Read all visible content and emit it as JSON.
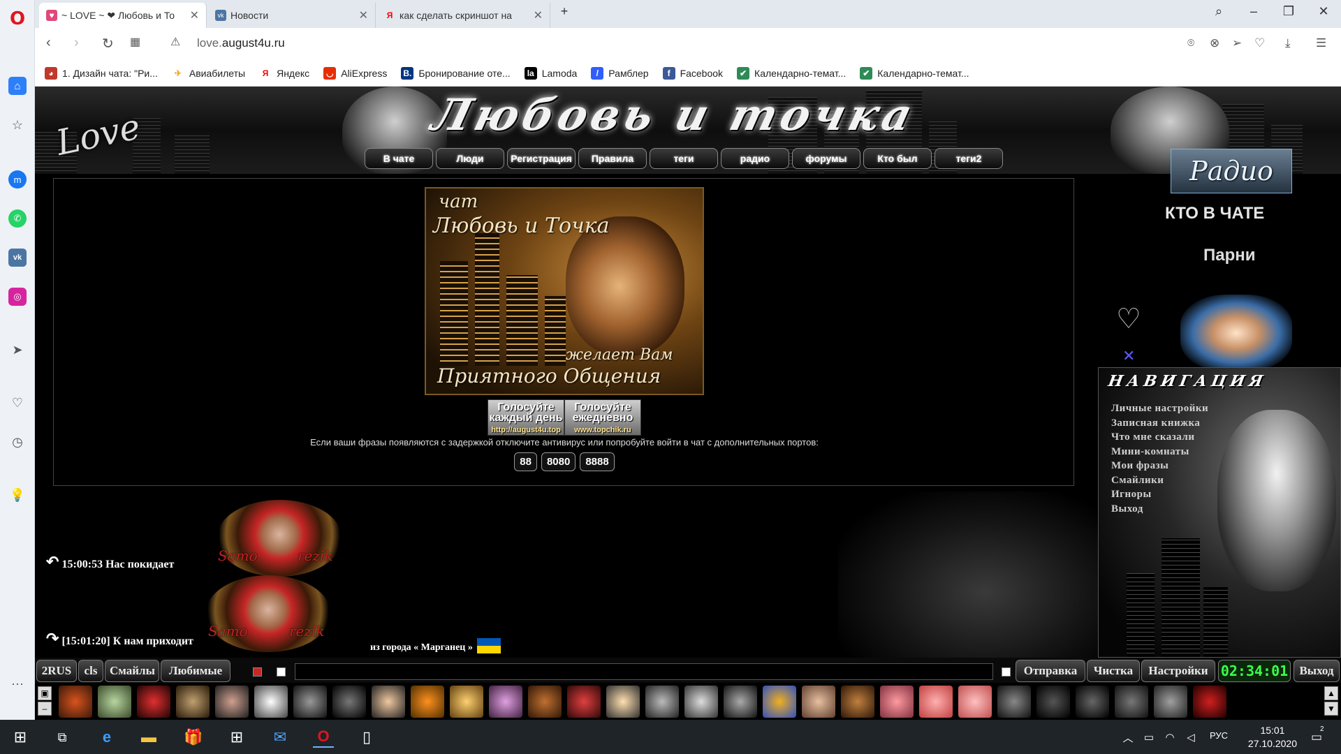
{
  "browser": {
    "tabs": [
      {
        "title": "~ LOVE ~ ❤ Любовь и То",
        "active": true
      },
      {
        "title": "Новости",
        "active": false
      },
      {
        "title": "как сделать скриншот на",
        "active": false
      }
    ],
    "url_host": "love.",
    "url_domain": "august4u.ru",
    "bookmarks": [
      {
        "label": "1. Дизайн чата: \"Ри...",
        "icon": "pizza-icon",
        "color": "#c0392b"
      },
      {
        "label": "Авиабилеты",
        "icon": "airplane-icon",
        "color": "#f5a623"
      },
      {
        "label": "Яндекс",
        "icon": "yandex-icon",
        "color": "#ff0000"
      },
      {
        "label": "AliExpress",
        "icon": "aliexpress-icon",
        "color": "#e62e04"
      },
      {
        "label": "Бронирование оте...",
        "icon": "booking-icon",
        "color": "#003580"
      },
      {
        "label": "Lamoda",
        "icon": "lamoda-icon",
        "color": "#000000"
      },
      {
        "label": "Рамблер",
        "icon": "rambler-icon",
        "color": "#315efb"
      },
      {
        "label": "Facebook",
        "icon": "facebook-icon",
        "color": "#3b5998"
      },
      {
        "label": "Календарно-темат...",
        "icon": "check-icon",
        "color": "#2e8b57"
      },
      {
        "label": "Календарно-темат...",
        "icon": "check-icon",
        "color": "#2e8b57"
      }
    ]
  },
  "site": {
    "banner_left": "Love",
    "banner_title": "Любовь и точка",
    "nav": [
      "В чате",
      "Люди",
      "Регистрация",
      "Правила",
      "теги",
      "радио",
      "форумы",
      "Кто был",
      "теги2"
    ],
    "greeting": {
      "line1": "чат",
      "line2": "Любовь и Точка",
      "line3": "желает Вам",
      "line4": "Приятного Общения"
    },
    "vote": [
      {
        "text": "Голосуйте каждый день",
        "url": "http://august4u.top"
      },
      {
        "text": "Голосуйте ежедневно",
        "url": "www.topchik.ru"
      }
    ],
    "ports_note": "Если ваши фразы появляются с задержкой отключите антивирус или попробуйте войти в чат с дополнительных портов:",
    "ports": [
      "88",
      "8080",
      "8888"
    ],
    "messages": [
      {
        "text": "15:00:53 Нас покидает",
        "sig": "Samo",
        "sig2": "rezik"
      },
      {
        "text": "[15:01:20] К нам приходит",
        "sig": "Samo",
        "sig2": "rezik",
        "suffix": "из города « Марганец »"
      }
    ],
    "radio": "Радио",
    "who_in_chat": "КТО В ЧАТЕ",
    "boys": "Парни",
    "navigation_title": "НАВИГАЦИЯ",
    "navigation": [
      "Личные настройки",
      "Записная книжка",
      "Что мне сказали",
      "Мини-комнаты",
      "Мои фразы",
      "Смайлики",
      "Игноры",
      "Выход"
    ],
    "input_bar": {
      "left_buttons": [
        "2RUS",
        "cls",
        "Смайлы",
        "Любимые"
      ],
      "message_value": "",
      "right_buttons": [
        "Отправка",
        "Чистка",
        "Настройки"
      ],
      "timer": "02:34:01",
      "exit": "Выход"
    }
  },
  "taskbar": {
    "lang": "РУС",
    "time": "15:01",
    "date": "27.10.2020",
    "notifications": "2"
  }
}
